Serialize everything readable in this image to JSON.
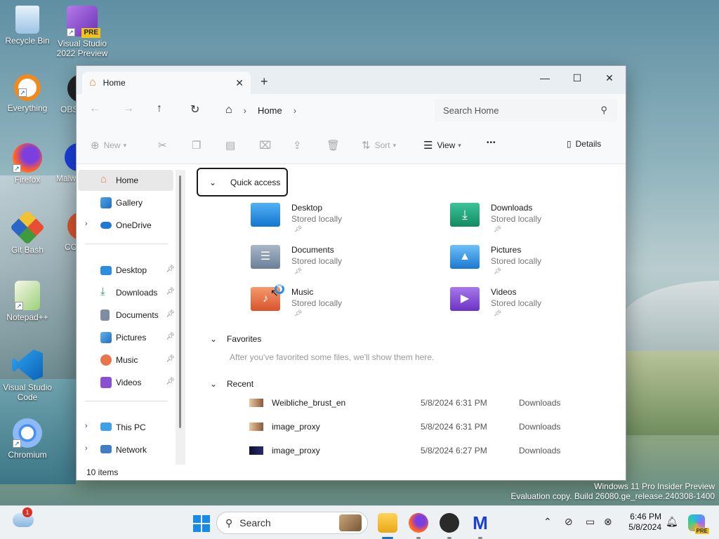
{
  "desktop": {
    "icons": [
      {
        "label": "Recycle Bin"
      },
      {
        "label": "Visual Studio 2022 Preview",
        "badge": "PRE"
      },
      {
        "label": "Everything"
      },
      {
        "label": "OBS"
      },
      {
        "label": "Firefox"
      },
      {
        "label": "Malw"
      },
      {
        "label": "Git Bash"
      },
      {
        "label": "CC"
      },
      {
        "label": "Notepad++"
      },
      {
        "label": "Visual Studio Code"
      },
      {
        "label": "Chromium"
      }
    ]
  },
  "window": {
    "tab_label": "Home",
    "tab_close": "✕",
    "new_tab": "+",
    "controls": {
      "minimize": "—",
      "maximize": "☐",
      "close": "✕"
    },
    "breadcrumb": "Home",
    "search_placeholder": "Search Home",
    "toolbar": {
      "new": "New",
      "sort": "Sort",
      "view": "View",
      "more": "•••",
      "details": "Details"
    },
    "sidebar": {
      "home": "Home",
      "gallery": "Gallery",
      "onedrive": "OneDrive",
      "pinned": [
        "Desktop",
        "Downloads",
        "Documents",
        "Pictures",
        "Music",
        "Videos"
      ],
      "this_pc": "This PC",
      "network": "Network"
    },
    "quick_access": {
      "header": "Quick access",
      "folders": [
        {
          "name": "Desktop",
          "sub": "Stored locally",
          "color": "#1e88e5"
        },
        {
          "name": "Downloads",
          "sub": "Stored locally",
          "color": "#1aa37a"
        },
        {
          "name": "Documents",
          "sub": "Stored locally",
          "color": "#7a8ea6"
        },
        {
          "name": "Pictures",
          "sub": "Stored locally",
          "color": "#2b8fe0"
        },
        {
          "name": "Music",
          "sub": "Stored locally",
          "color": "#e8764a"
        },
        {
          "name": "Videos",
          "sub": "Stored locally",
          "color": "#8b4fd6"
        }
      ]
    },
    "favorites": {
      "header": "Favorites",
      "empty": "After you've favorited some files, we'll show them here."
    },
    "recent": {
      "header": "Recent",
      "rows": [
        {
          "name": "Weibliche_brust_en",
          "date": "5/8/2024 6:31 PM",
          "location": "Downloads"
        },
        {
          "name": "image_proxy",
          "date": "5/8/2024 6:31 PM",
          "location": "Downloads"
        },
        {
          "name": "image_proxy",
          "date": "5/8/2024 6:27 PM",
          "location": "Downloads"
        }
      ]
    },
    "status": "10 items"
  },
  "watermark": {
    "line1": "Windows 11 Pro Insider Preview",
    "line2": "Evaluation copy. Build 26080.ge_release.240308-1400"
  },
  "taskbar": {
    "search_label": "Search",
    "weather_badge": "1",
    "time": "6:46 PM",
    "date": "5/8/2024",
    "copilot_badge": "PRE"
  }
}
